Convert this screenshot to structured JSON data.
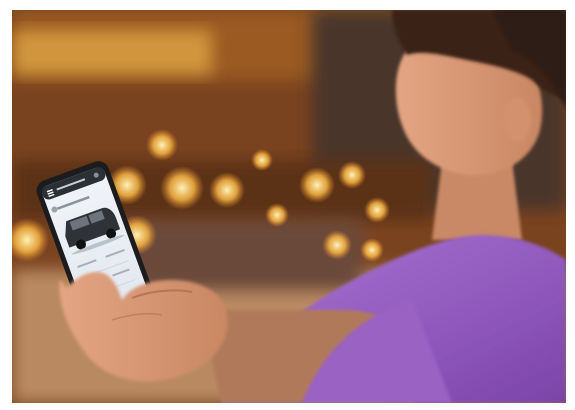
{
  "photo": {
    "description_name": "person-holding-smartphone-photo"
  },
  "phone_screen": {
    "header_icon": "hamburger-menu-icon",
    "vehicle_icon": "van-icon",
    "text_lines": []
  },
  "colors": {
    "shirt": "#9a62c2",
    "bokeh_warm": "#f5b646",
    "background_warm": "#8b4a1c",
    "phone_body": "#1c1c1e",
    "screen": "#e9eef4"
  }
}
